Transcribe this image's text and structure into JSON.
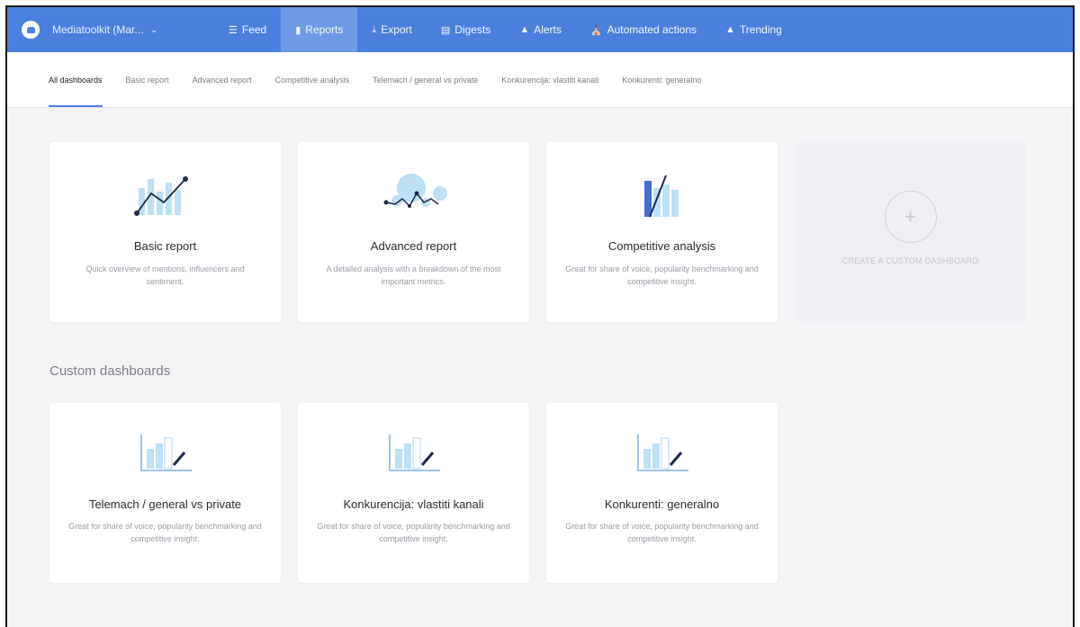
{
  "topnav": {
    "brand": "Mediatoolkit (Mar...",
    "items": [
      {
        "label": "Feed",
        "icon": "list-icon"
      },
      {
        "label": "Reports",
        "icon": "bar-chart-icon"
      },
      {
        "label": "Export",
        "icon": "download-icon"
      },
      {
        "label": "Digests",
        "icon": "newspaper-icon"
      },
      {
        "label": "Alerts",
        "icon": "bell-icon"
      },
      {
        "label": "Automated actions",
        "icon": "bank-icon"
      },
      {
        "label": "Trending",
        "icon": "flame-icon"
      }
    ],
    "active": "Reports",
    "accent": "#4a7fdd"
  },
  "subnav": {
    "tabs": [
      "All dashboards",
      "Basic report",
      "Advanced report",
      "Competitive analysis",
      "Telemach / general vs private",
      "Konkurencija: vlastiti kanali",
      "Konkurenti: generalno"
    ],
    "active": "All dashboards"
  },
  "templates": [
    {
      "title": "Basic report",
      "desc": "Quick overview of mentions, influencers and sentiment.",
      "icon": "basic-report-illustration"
    },
    {
      "title": "Advanced report",
      "desc": "A detailed analysis with a breakdown of the most important metrics.",
      "icon": "advanced-report-illustration"
    },
    {
      "title": "Competitive analysis",
      "desc": "Great for share of voice, popularity benchmarking and competitive insight.",
      "icon": "competitive-analysis-illustration"
    }
  ],
  "create_card": {
    "label": "CREATE A CUSTOM DASHBOARD",
    "plus": "+"
  },
  "custom_section": {
    "title": "Custom dashboards",
    "dashboards": [
      {
        "title": "Telemach / general vs private",
        "desc": "Great for share of voice, popularity benchmarking and competitive insight."
      },
      {
        "title": "Konkurencija: vlastiti kanali",
        "desc": "Great for share of voice, popularity benchmarking and competitive insight."
      },
      {
        "title": "Konkurenti: generalno",
        "desc": "Great for share of voice, popularity benchmarking and competitive insight."
      }
    ]
  }
}
